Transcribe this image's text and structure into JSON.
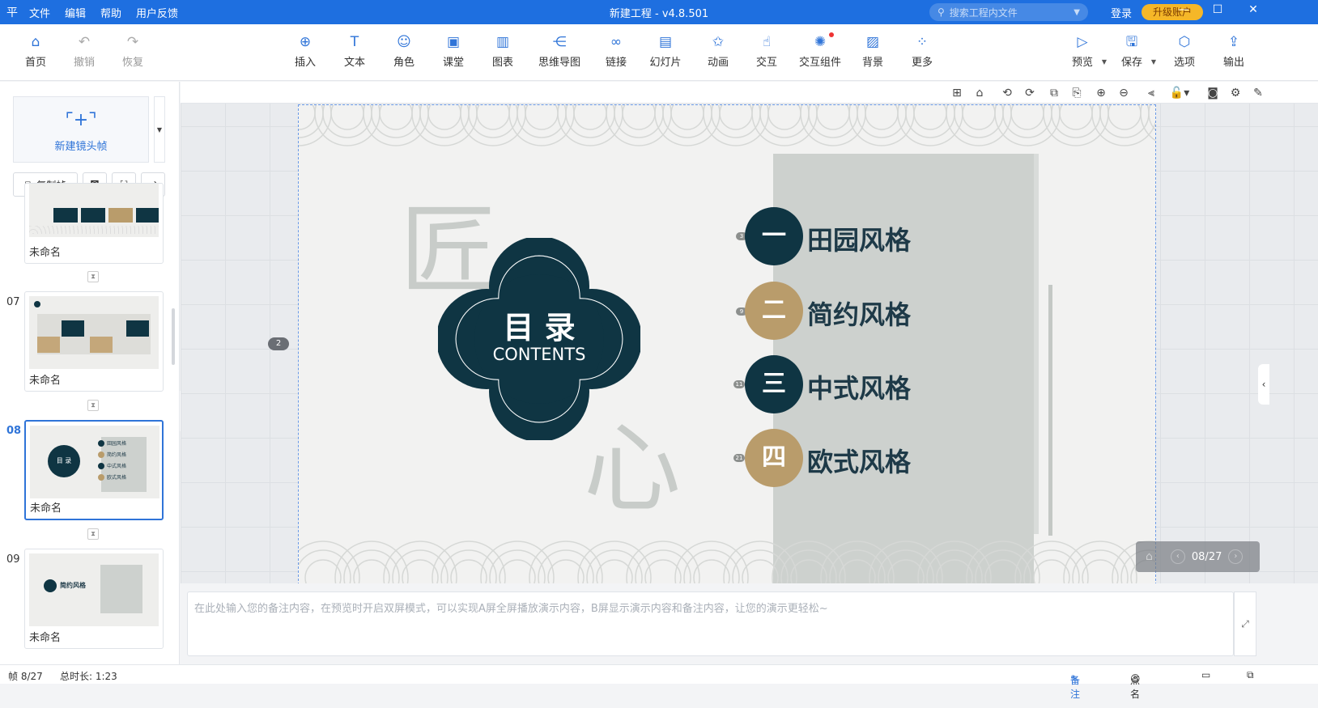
{
  "titlebar": {
    "logo": "平",
    "menu": [
      "文件",
      "编辑",
      "帮助",
      "用户反馈"
    ],
    "title": "新建工程 - v4.8.501",
    "search_placeholder": "搜索工程内文件",
    "login": "登录",
    "upgrade": "升级账户"
  },
  "toolbar": {
    "left": [
      {
        "label": "首页",
        "icon": "home-icon"
      },
      {
        "label": "撤销",
        "icon": "undo-icon"
      },
      {
        "label": "恢复",
        "icon": "redo-icon"
      }
    ],
    "center": [
      {
        "label": "插入",
        "icon": "plus-circle-icon"
      },
      {
        "label": "文本",
        "icon": "text-icon"
      },
      {
        "label": "角色",
        "icon": "character-icon"
      },
      {
        "label": "课堂",
        "icon": "classroom-icon"
      },
      {
        "label": "图表",
        "icon": "chart-icon"
      },
      {
        "label": "思维导图",
        "icon": "mindmap-icon"
      },
      {
        "label": "链接",
        "icon": "link-icon"
      },
      {
        "label": "幻灯片",
        "icon": "slide-icon"
      },
      {
        "label": "动画",
        "icon": "animation-icon"
      },
      {
        "label": "交互",
        "icon": "interact-icon"
      },
      {
        "label": "交互组件",
        "icon": "interact-component-icon"
      },
      {
        "label": "背景",
        "icon": "background-icon"
      },
      {
        "label": "更多",
        "icon": "more-icon"
      }
    ],
    "right": [
      {
        "label": "预览",
        "icon": "preview-icon"
      },
      {
        "label": "保存",
        "icon": "save-icon"
      },
      {
        "label": "选项",
        "icon": "options-icon"
      },
      {
        "label": "输出",
        "icon": "export-icon"
      }
    ]
  },
  "leftpanel": {
    "new_frame_label": "新建镜头帧",
    "copy_frame_label": "复制帧",
    "thumbnails": [
      {
        "num": "",
        "name": "未命名"
      },
      {
        "num": "07",
        "name": "未命名"
      },
      {
        "num": "08",
        "name": "未命名"
      },
      {
        "num": "09",
        "name": "未命名"
      }
    ],
    "thumb8_items": [
      "田园风格",
      "简约风格",
      "中式风格",
      "欧式风格"
    ],
    "thumb9_title": "简约风格"
  },
  "slide": {
    "char1": "匠",
    "char2": "心",
    "center_title": "目 录",
    "center_subtitle": "CONTENTS",
    "frame_badge": "2",
    "items": [
      {
        "num": "一",
        "label": "田园风格",
        "dot": "3",
        "color": "#0f3543"
      },
      {
        "num": "二",
        "label": "简约风格",
        "dot": "9",
        "color": "#b99c6b"
      },
      {
        "num": "三",
        "label": "中式风格",
        "dot": "11",
        "color": "#0f3543"
      },
      {
        "num": "四",
        "label": "欧式风格",
        "dot": "21",
        "color": "#b99c6b"
      }
    ]
  },
  "pager": {
    "text": "08/27"
  },
  "notes": {
    "placeholder": "在此处输入您的备注内容，在预览时开启双屏模式，可以实现A屏全屏播放演示内容，B屏显示演示内容和备注内容，让您的演示更轻松~"
  },
  "status": {
    "frame": "帧 8/27",
    "duration": "总时长: 1:23",
    "notes_btn": "备注",
    "rollcall_btn": "点名"
  },
  "colors": {
    "accent": "#1e6fe0",
    "dark_teal": "#0f3543",
    "gold": "#b99c6b"
  }
}
